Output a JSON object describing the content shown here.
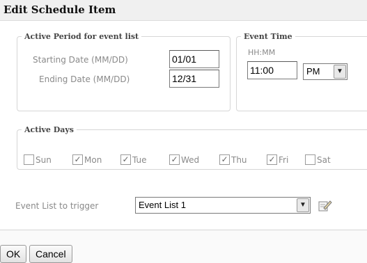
{
  "dialog": {
    "title": "Edit Schedule Item"
  },
  "active_period": {
    "legend": "Active Period for event list",
    "start_label": "Starting Date (MM/DD)",
    "start_value": "01/01",
    "end_label": "Ending Date (MM/DD)",
    "end_value": "12/31"
  },
  "event_time": {
    "legend": "Event Time",
    "format_hint": "HH:MM",
    "time_value": "11:00",
    "ampm_value": "PM"
  },
  "active_days": {
    "legend": "Active Days",
    "days": [
      {
        "label": "Sun",
        "checked": false
      },
      {
        "label": "Mon",
        "checked": true
      },
      {
        "label": "Tue",
        "checked": true
      },
      {
        "label": "Wed",
        "checked": true
      },
      {
        "label": "Thu",
        "checked": true
      },
      {
        "label": "Fri",
        "checked": true
      },
      {
        "label": "Sat",
        "checked": false
      }
    ]
  },
  "trigger": {
    "label": "Event List to trigger",
    "selected": "Event List 1",
    "edit_icon": "edit-list-icon"
  },
  "buttons": {
    "ok": "OK",
    "cancel": "Cancel"
  }
}
